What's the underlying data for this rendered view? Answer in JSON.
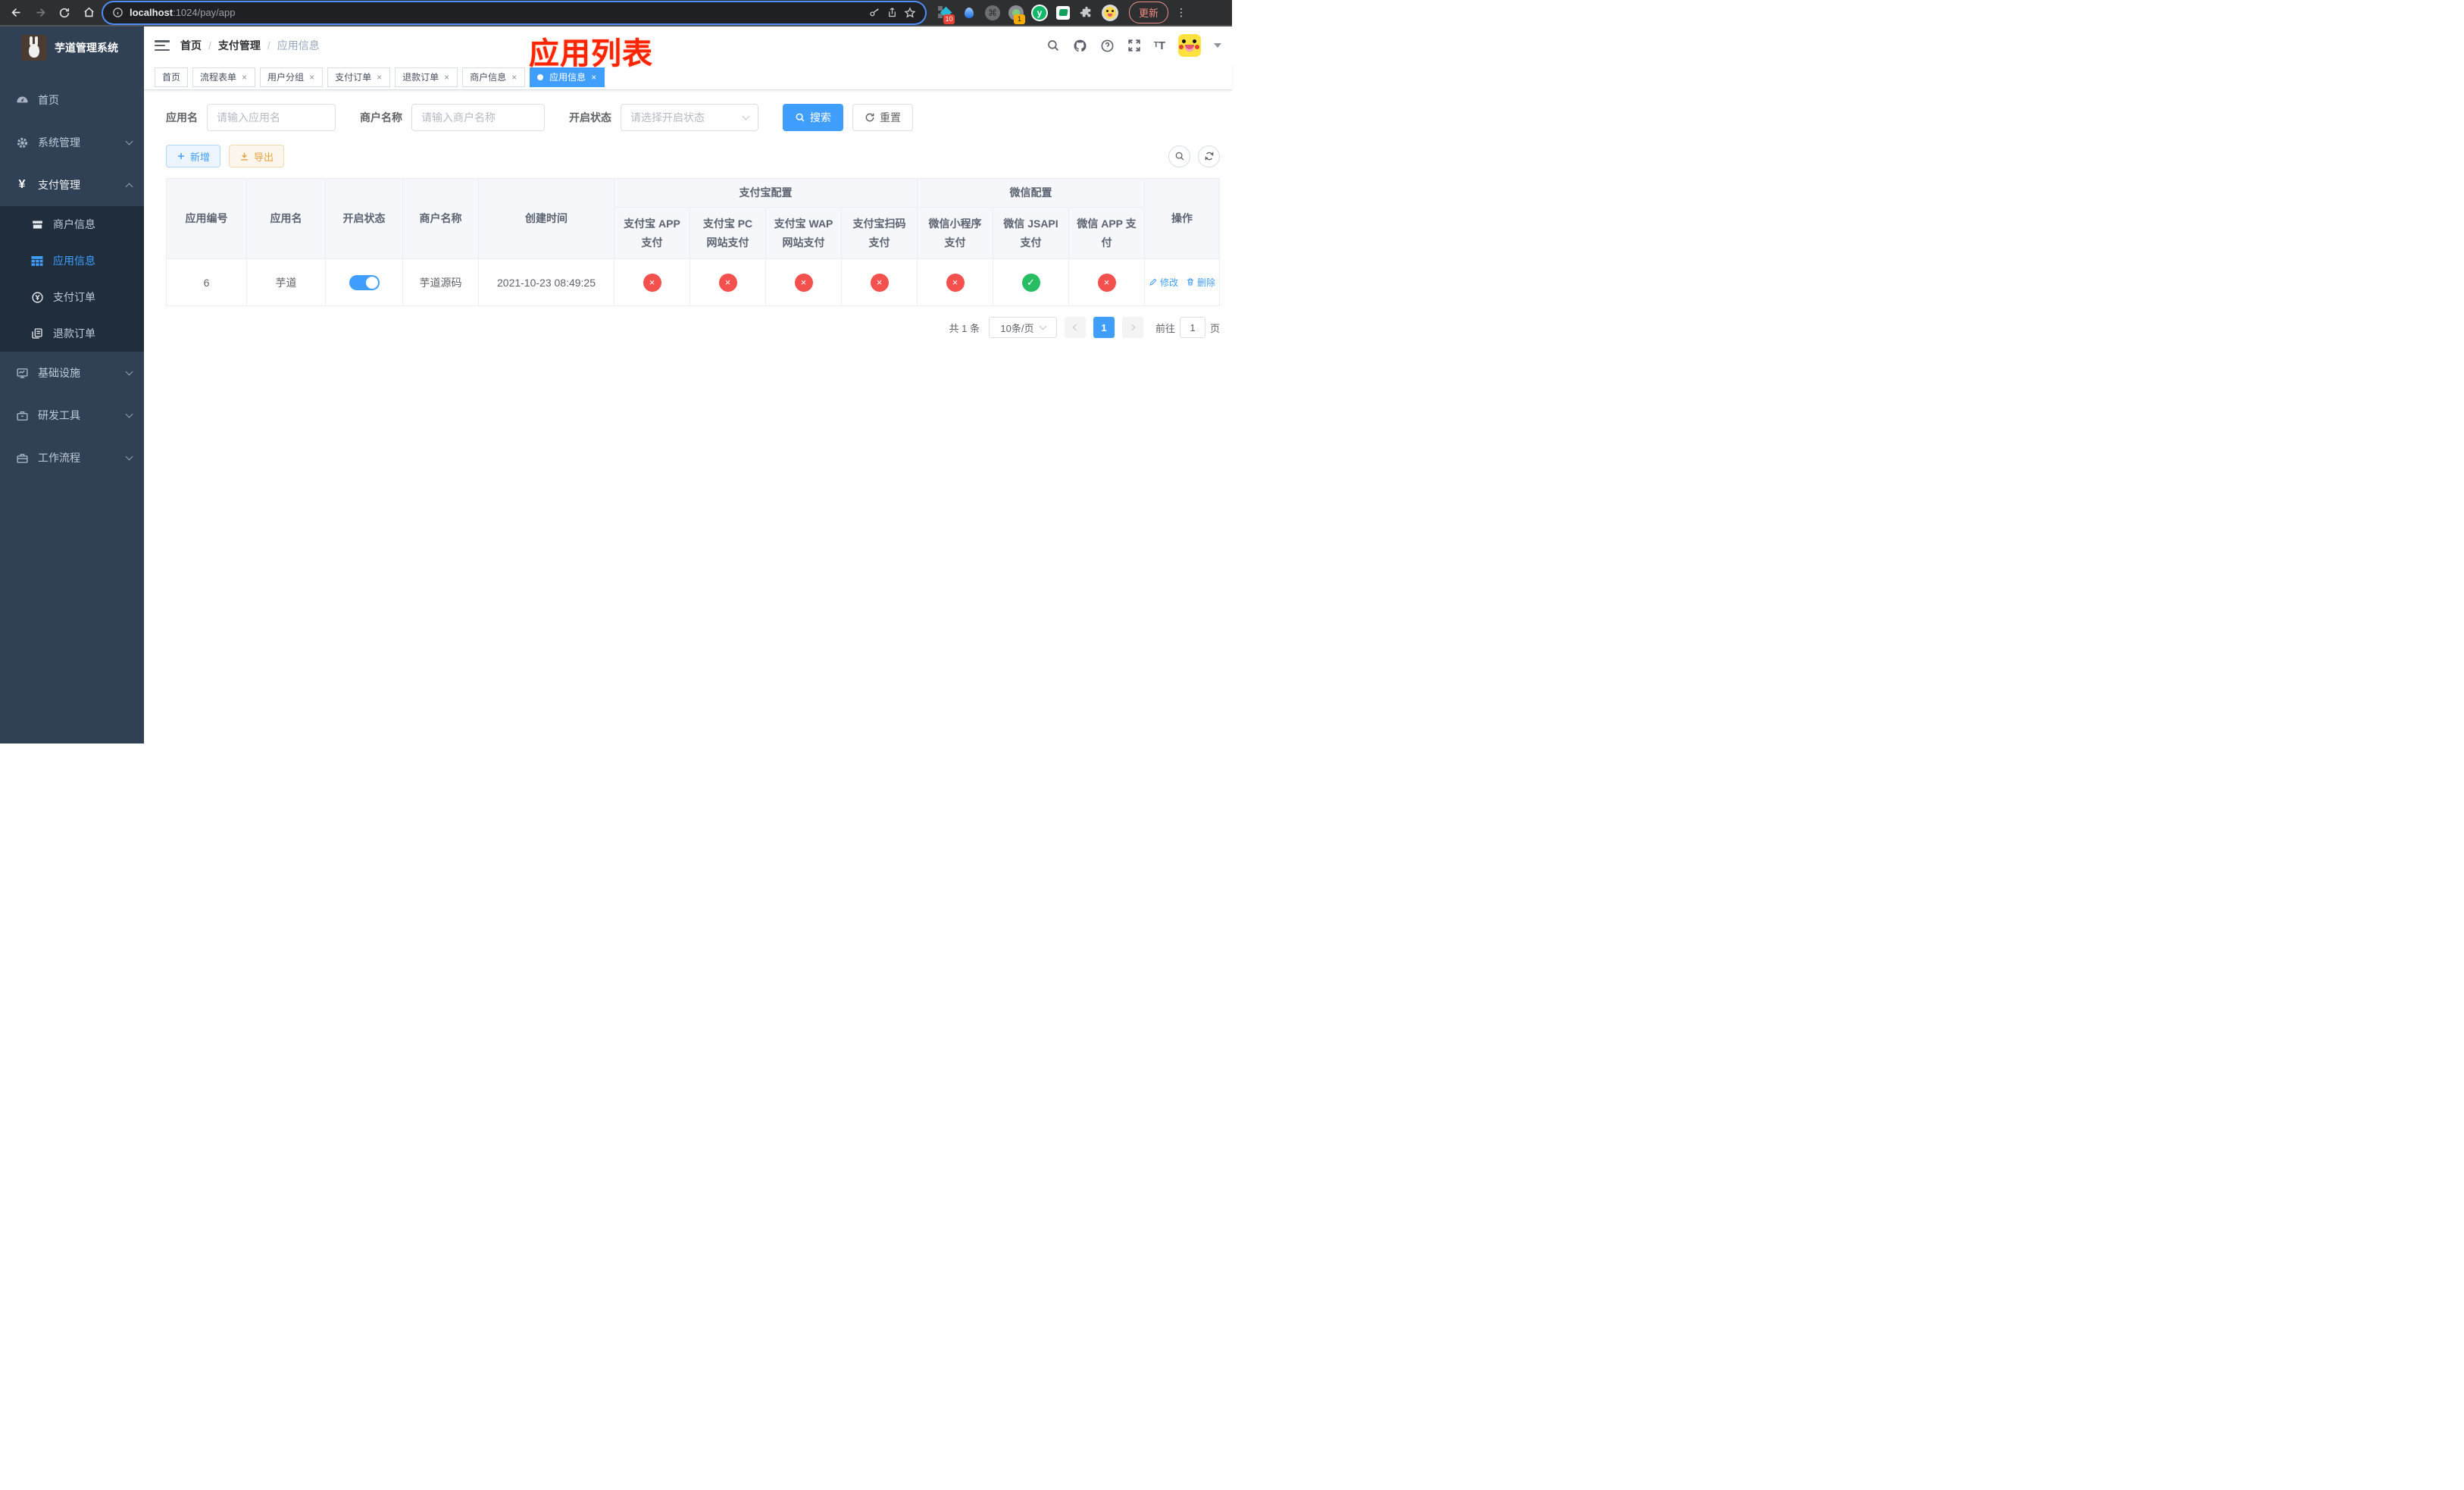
{
  "browser": {
    "url_host": "localhost",
    "url_path": ":1024/pay/app",
    "ext_badge_devtools": "10",
    "ext_badge_recorder": "1",
    "ext_y_letter": "y",
    "update_label": "更新"
  },
  "sidebar": {
    "title": "芋道管理系统",
    "items": [
      {
        "label": "首页"
      },
      {
        "label": "系统管理"
      },
      {
        "label": "支付管理"
      },
      {
        "label": "基础设施"
      },
      {
        "label": "研发工具"
      },
      {
        "label": "工作流程"
      }
    ],
    "sub_items": [
      {
        "label": "商户信息"
      },
      {
        "label": "应用信息"
      },
      {
        "label": "支付订单"
      },
      {
        "label": "退款订单"
      }
    ]
  },
  "breadcrumb": {
    "items": [
      "首页",
      "支付管理",
      "应用信息"
    ]
  },
  "annotation": {
    "title": "应用列表"
  },
  "tabs": [
    {
      "label": "首页"
    },
    {
      "label": "流程表单"
    },
    {
      "label": "用户分组"
    },
    {
      "label": "支付订单"
    },
    {
      "label": "退款订单"
    },
    {
      "label": "商户信息"
    },
    {
      "label": "应用信息"
    }
  ],
  "filter": {
    "app_name_label": "应用名",
    "app_name_placeholder": "请输入应用名",
    "merchant_label": "商户名称",
    "merchant_placeholder": "请输入商户名称",
    "status_label": "开启状态",
    "status_placeholder": "请选择开启状态",
    "search_label": "搜索",
    "reset_label": "重置"
  },
  "toolbar": {
    "add_label": "新增",
    "export_label": "导出"
  },
  "table": {
    "columns": [
      "应用编号",
      "应用名",
      "开启状态",
      "商户名称",
      "创建时间"
    ],
    "groups": [
      {
        "label": "支付宝配置",
        "children": [
          "支付宝 APP 支付",
          "支付宝 PC 网站支付",
          "支付宝 WAP 网站支付",
          "支付宝扫码支付"
        ]
      },
      {
        "label": "微信配置",
        "children": [
          "微信小程序支付",
          "微信 JSAPI 支付",
          "微信 APP 支付"
        ]
      }
    ],
    "actions_column": "操作",
    "row": {
      "id": "6",
      "name": "芋道",
      "enabled": true,
      "merchant": "芋道源码",
      "created_at": "2021-10-23 08:49:25",
      "pay_configs": [
        "disabled",
        "disabled",
        "disabled",
        "disabled",
        "disabled",
        "enabled",
        "disabled"
      ],
      "edit_label": "修改",
      "delete_label": "删除"
    }
  },
  "pagination": {
    "total_text": "共 1 条",
    "page_size": "10条/页",
    "current_page": "1",
    "goto_label": "前往",
    "goto_value": "1",
    "page_suffix": "页"
  },
  "colors": {
    "accent": "#409eff",
    "danger": "#f4504e",
    "success": "#29bd63",
    "annotation": "#ff2400"
  }
}
